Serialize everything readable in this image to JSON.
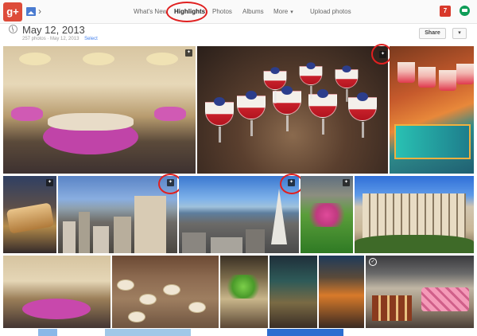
{
  "topbar": {
    "logo_text": "g+",
    "nav": {
      "whats_new": "What's New",
      "highlights": "Highlights",
      "photos": "Photos",
      "albums": "Albums",
      "more": "More",
      "upload": "Upload photos"
    },
    "notification_count": "7"
  },
  "header": {
    "title": "May 12, 2013",
    "photo_count": "257 photos",
    "date_small": "May 12, 2013",
    "select_label": "Select",
    "share_label": "Share",
    "dropdown_glyph": "▾"
  },
  "photos": [
    {
      "name": "ballroom-buffet",
      "auto_enhanced": true
    },
    {
      "name": "dessert-glasses",
      "auto_enhanced": true,
      "highlighted": true
    },
    {
      "name": "dessert-cups",
      "auto_enhanced": false
    },
    {
      "name": "pastry-closeup",
      "auto_enhanced": true
    },
    {
      "name": "city-skyline",
      "auto_enhanced": true,
      "highlighted": true
    },
    {
      "name": "transamerica-view",
      "auto_enhanced": true,
      "highlighted": true
    },
    {
      "name": "flower-garden",
      "auto_enhanced": true
    },
    {
      "name": "hotel-facade",
      "auto_enhanced": false
    },
    {
      "name": "ballroom-wide",
      "auto_enhanced": false
    },
    {
      "name": "food-platters",
      "auto_enhanced": false
    },
    {
      "name": "vegetable-display",
      "auto_enhanced": false
    },
    {
      "name": "glass-cups",
      "auto_enhanced": false
    },
    {
      "name": "drinks-display",
      "auto_enhanced": false
    },
    {
      "name": "dessert-table",
      "auto_enhanced": false
    }
  ],
  "colors": {
    "brand_red": "#dd4b39",
    "link_blue": "#427fed",
    "annotation_red": "#e02020",
    "hangouts_green": "#0f9d58"
  }
}
